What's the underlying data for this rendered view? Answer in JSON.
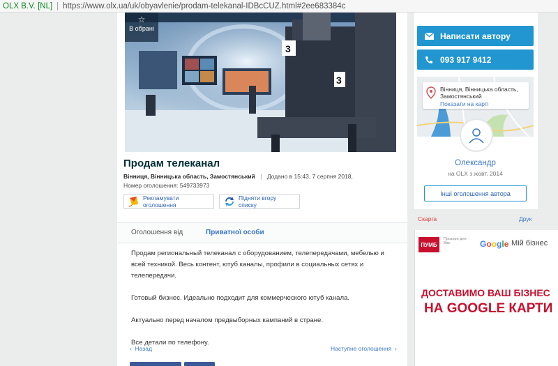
{
  "browser": {
    "cert_label": "OLX B.V. [NL]",
    "url": "https://www.olx.ua/uk/obyavlenie/prodam-telekanal-IDBcCUZ.html#2ee683384c"
  },
  "listing": {
    "favorite_label": "В обрані",
    "title": "Продам телеканал",
    "location": "Вінниця, Вінницька область, Замостянський",
    "added": "Додано в 15:43, 7 серпня 2018,",
    "ad_number": "Номер оголошення: 549733973",
    "promote_label": "Рекламувати оголошення",
    "raise_label": "Підняти вгору списку",
    "tab_from": "Оголошення від",
    "tab_private": "Приватної особи",
    "description": [
      "Продам региональный телеканал с оборудованием, телепередачами, мебелью и всей техникой. Весь контент, ютуб каналы, профили в социальных сетях и телепередачи.",
      "Готовый бизнес. Идеально подходит для коммерческого ютуб канала.",
      "Актуально перед началом предвыборных кампаний в стране.",
      "Все детали по телефону."
    ],
    "nav_back": "Назад",
    "nav_next": "Наступне оголошення"
  },
  "sidebar": {
    "message_label": "Написати автору",
    "phone": "093 917 9412",
    "map_location": "Вінниця, Вінницька область, Замостянський",
    "map_link": "Показати на карті",
    "user_name": "Олександр",
    "user_since": "на OLX з жовт. 2014",
    "other_ads_label": "Інші оголошення автора",
    "complain_label": "Скарга",
    "print_label": "Друк"
  },
  "ad": {
    "bank_logo": "ПУМБ",
    "bank_sub": "Прозоро для Вас",
    "google": "Google",
    "my_business": "Мій бізнес",
    "headline_1": "ДОСТАВИМО ВАШ БІЗНЕС",
    "headline_2": "НА GOOGLE КАРТИ"
  },
  "colors": {
    "accent": "#2196d0",
    "link": "#3a77c7",
    "ad_red": "#c8102e"
  }
}
